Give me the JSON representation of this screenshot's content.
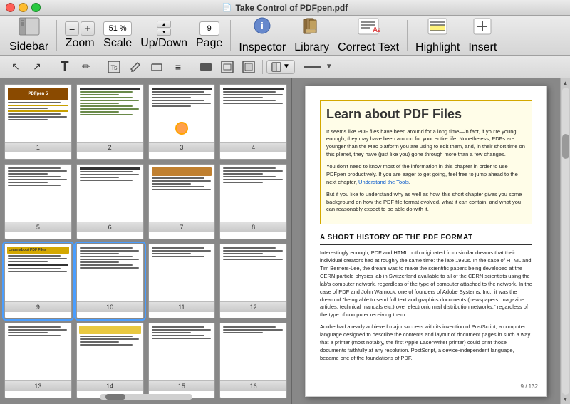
{
  "window": {
    "title": "Take Control of PDFpen.pdf",
    "controls": {
      "close": "×",
      "min": "–",
      "max": "+"
    }
  },
  "toolbar": {
    "sidebar_label": "Sidebar",
    "zoom_minus": "–",
    "zoom_plus": "+",
    "scale_value": "51 %",
    "updown_label": "Up/Down",
    "page_value": "9",
    "page_label": "Page",
    "inspector_label": "Inspector",
    "library_label": "Library",
    "correct_text_label": "Correct Text",
    "highlight_label": "Highlight",
    "insert_label": "Insert"
  },
  "toolbar2": {
    "tools": [
      "↖",
      "↗",
      "⊞",
      "T",
      "✏",
      "⊙",
      "≡",
      "▬",
      "⊡",
      "⊟",
      "⊡",
      "◱",
      "↕"
    ]
  },
  "sidebar": {
    "pages": [
      {
        "num": "1",
        "type": "cover"
      },
      {
        "num": "2",
        "type": "toc"
      },
      {
        "num": "3",
        "type": "intro",
        "has_marker": true
      },
      {
        "num": "4",
        "type": "chapter"
      },
      {
        "num": "5",
        "type": "text"
      },
      {
        "num": "6",
        "type": "text"
      },
      {
        "num": "7",
        "type": "text"
      },
      {
        "num": "8",
        "type": "text"
      },
      {
        "num": "9",
        "type": "featured",
        "selected": true
      },
      {
        "num": "10",
        "type": "featured2",
        "selected": true
      },
      {
        "num": "11",
        "type": "text"
      },
      {
        "num": "12",
        "type": "text"
      },
      {
        "num": "13",
        "type": "text"
      },
      {
        "num": "14",
        "type": "yellow"
      },
      {
        "num": "15",
        "type": "text"
      },
      {
        "num": "16",
        "type": "text"
      }
    ]
  },
  "pdf": {
    "heading": "Learn about PDF Files",
    "para1": "It seems like PDF files have been around for a long time—in fact, if you're young enough, they may have been around for your entire life. Nonetheless, PDFs are younger than the Mac platform you are using to edit them, and, in their short time on this planet, they have (just like you) gone through more than a few changes.",
    "para2": "You don't need to know most of the information in this chapter in order to use PDFpen productively. If you are eager to get going, feel free to jump ahead to the next chapter, Understand the Tools.",
    "para3": "But if you like to understand why as well as how, this short chapter gives you some background on how the PDF file format evolved, what it can contain, and what you can reasonably expect to be able do with it.",
    "section_title": "A SHORT HISTORY OF THE PDF FORMAT",
    "para4": "Interestingly enough, PDF and HTML both originated from similar dreams that their individual creators had at roughly the same time: the late 1980s. In the case of HTML and Tim Berners-Lee, the dream was to make the scientific papers being developed at the CERN particle physics lab in Switzerland available to all of the CERN scientists using the lab's computer network, regardless of the type of computer attached to the network. In the case of PDF and John Warnock, one of founders of Adobe Systems, Inc., it was the dream of \"being able to send full text and graphics documents (newspapers, magazine articles, technical manuals etc.) over electronic mail distribution networks,\" regardless of the type of computer receiving them.",
    "para5": "Adobe had already achieved major success with its invention of PostScript, a computer language designed to describe the contents and layout of document pages in such a way that a printer (most notably, the first Apple LaserWriter printer) could print those documents faithfully at any resolution. PostScript, a device-independent language, became one of the foundations of PDF.",
    "link_text": "Understand the Tools",
    "page_num": "9 / 132"
  }
}
